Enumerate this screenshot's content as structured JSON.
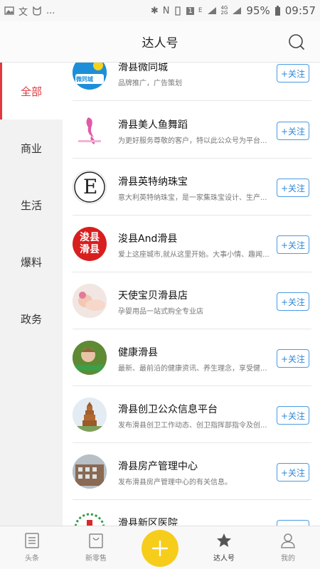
{
  "status_bar": {
    "left_icons": [
      "image-icon",
      "translate-icon",
      "cat-icon",
      "more-dots"
    ],
    "network_labels": [
      "E",
      "4G",
      "2G"
    ],
    "battery": "95%",
    "time": "09:57"
  },
  "header": {
    "title": "达人号",
    "search_icon": "search-icon"
  },
  "sidebar": {
    "items": [
      {
        "label": "全部",
        "active": true
      },
      {
        "label": "商业",
        "active": false
      },
      {
        "label": "生活",
        "active": false
      },
      {
        "label": "爆料",
        "active": false
      },
      {
        "label": "政务",
        "active": false
      }
    ]
  },
  "follow_label": "+关注",
  "accounts": [
    {
      "name": "滑县微同城",
      "desc": "品牌推广，广告策划",
      "avatar_text": "微同城"
    },
    {
      "name": "滑县美人鱼舞蹈",
      "desc": "为更好服务尊敬的客户，特以此公众号为平台...",
      "avatar_text": ""
    },
    {
      "name": "滑县英特纳珠宝",
      "desc": "意大利英特纳珠宝，是一家集珠宝设计、生产...",
      "avatar_text": "E"
    },
    {
      "name": "浚县And滑县",
      "desc": "爱上这座城市,就从这里开始。大事小情、趣闻...",
      "avatar_text": "浚县滑县"
    },
    {
      "name": "天使宝贝滑县店",
      "desc": "孕婴用品一站式购全专业店",
      "avatar_text": ""
    },
    {
      "name": "健康滑县",
      "desc": "最新、最前沿的健康资讯、养生理念，享受健...",
      "avatar_text": ""
    },
    {
      "name": "滑县创卫公众信息平台",
      "desc": "发布滑县创卫工作动态、创卫指挥部指令及创...",
      "avatar_text": ""
    },
    {
      "name": "滑县房产管理中心",
      "desc": "发布滑县房产管理中心的有关信息。",
      "avatar_text": ""
    },
    {
      "name": "滑县新区医院",
      "desc": "",
      "avatar_text": ""
    }
  ],
  "bottom_nav": {
    "items": [
      {
        "label": "头条",
        "icon": "news-icon"
      },
      {
        "label": "新零售",
        "icon": "shopping-bag-icon"
      },
      {
        "label": "",
        "icon": "plus-icon"
      },
      {
        "label": "达人号",
        "icon": "star-icon"
      },
      {
        "label": "我的",
        "icon": "person-icon"
      }
    ]
  },
  "colors": {
    "accent_red": "#e0393e",
    "follow_blue": "#2f86d6",
    "plus_yellow": "#f7cd1c"
  }
}
